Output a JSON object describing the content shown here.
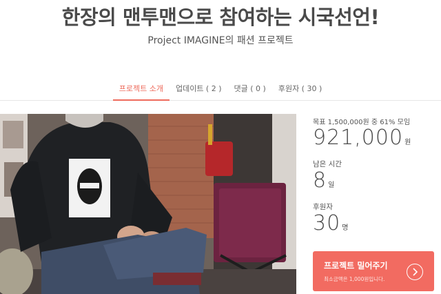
{
  "header": {
    "title": "한장의 맨투맨으로 참여하는 시국선언!",
    "subtitle": "Project IMAGINE의 패션 프로젝트"
  },
  "tabs": [
    {
      "label": "프로젝트 소개",
      "active": true
    },
    {
      "label": "업데이트 ( 2 )",
      "active": false
    },
    {
      "label": "댓글 ( 0 )",
      "active": false
    },
    {
      "label": "후원자 ( 30 )",
      "active": false
    }
  ],
  "stats": {
    "goal_text": "목표 1,500,000원 중 61% 모임",
    "amount": "921,000",
    "amount_unit": "원",
    "time_label": "남은 시간",
    "days": "8",
    "days_unit": "일",
    "backers_label": "후원자",
    "backers": "30",
    "backers_unit": "명"
  },
  "fund_button": {
    "label": "프로젝트 밀어주기",
    "note": "최소금액은 1,000원입니다.",
    "icon": "chevron-right-icon"
  },
  "colors": {
    "accent": "#f26b61",
    "tab_active": "#ee6b5c"
  }
}
